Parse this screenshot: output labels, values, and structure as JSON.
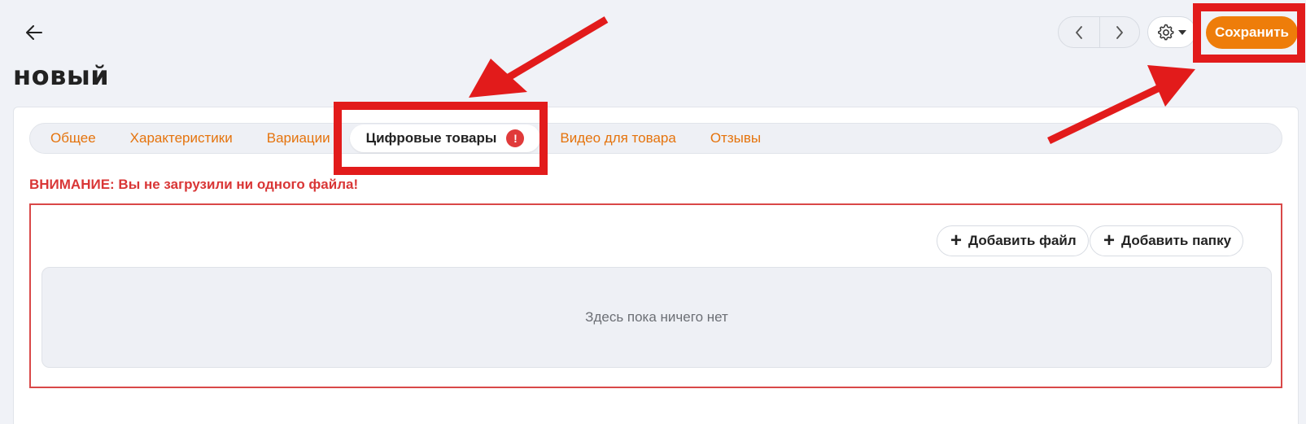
{
  "page": {
    "title": "новый"
  },
  "header": {
    "save_label": "Сохранить",
    "back_icon": "arrow-left-icon",
    "prev_icon": "chevron-left-icon",
    "next_icon": "chevron-right-icon",
    "settings_icon": "gear-icon"
  },
  "tabs": [
    {
      "label": "Общее",
      "active": false
    },
    {
      "label": "Характеристики",
      "active": false
    },
    {
      "label": "Вариации",
      "active": false
    },
    {
      "label": "Цифровые товары",
      "active": true,
      "badge": "!"
    },
    {
      "label": "Видео для товара",
      "active": false
    },
    {
      "label": "Отзывы",
      "active": false
    }
  ],
  "warning": "ВНИМАНИЕ: Вы не загрузили ни одного файла!",
  "upload": {
    "add_file_label": "Добавить файл",
    "add_folder_label": "Добавить папку",
    "empty_text": "Здесь пока ничего нет"
  },
  "colors": {
    "accent": "#ee7d0a",
    "tab_text": "#e5730c",
    "warning": "#d93636",
    "annotation": "#e21b1b",
    "background": "#f0f2f7"
  }
}
